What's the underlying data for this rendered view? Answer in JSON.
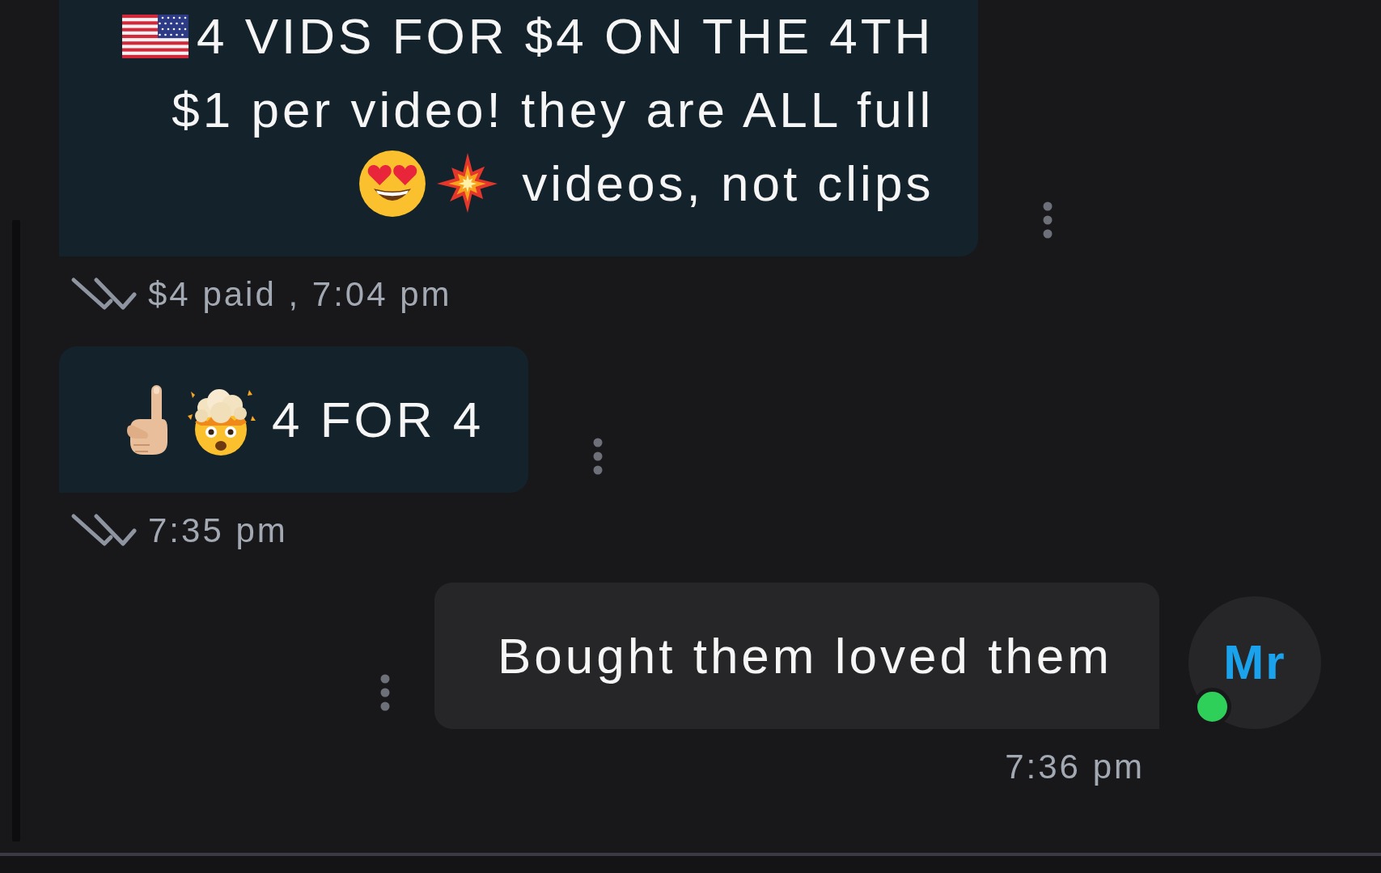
{
  "messages": [
    {
      "kind": "outgoing",
      "lines": [
        "4 VIDS FOR $4 ON THE 4TH",
        "$1 per video! they are ALL full",
        "videos, not clips"
      ],
      "meta": "$4 paid , 7:04 pm",
      "read": true
    },
    {
      "kind": "outgoing",
      "lines": [
        "4 FOR 4"
      ],
      "meta": "7:35 pm",
      "read": true
    },
    {
      "kind": "incoming",
      "sender": {
        "initials": "Mr",
        "online": true
      },
      "lines": [
        "Bought them loved them"
      ],
      "meta": "7:36 pm"
    }
  ]
}
